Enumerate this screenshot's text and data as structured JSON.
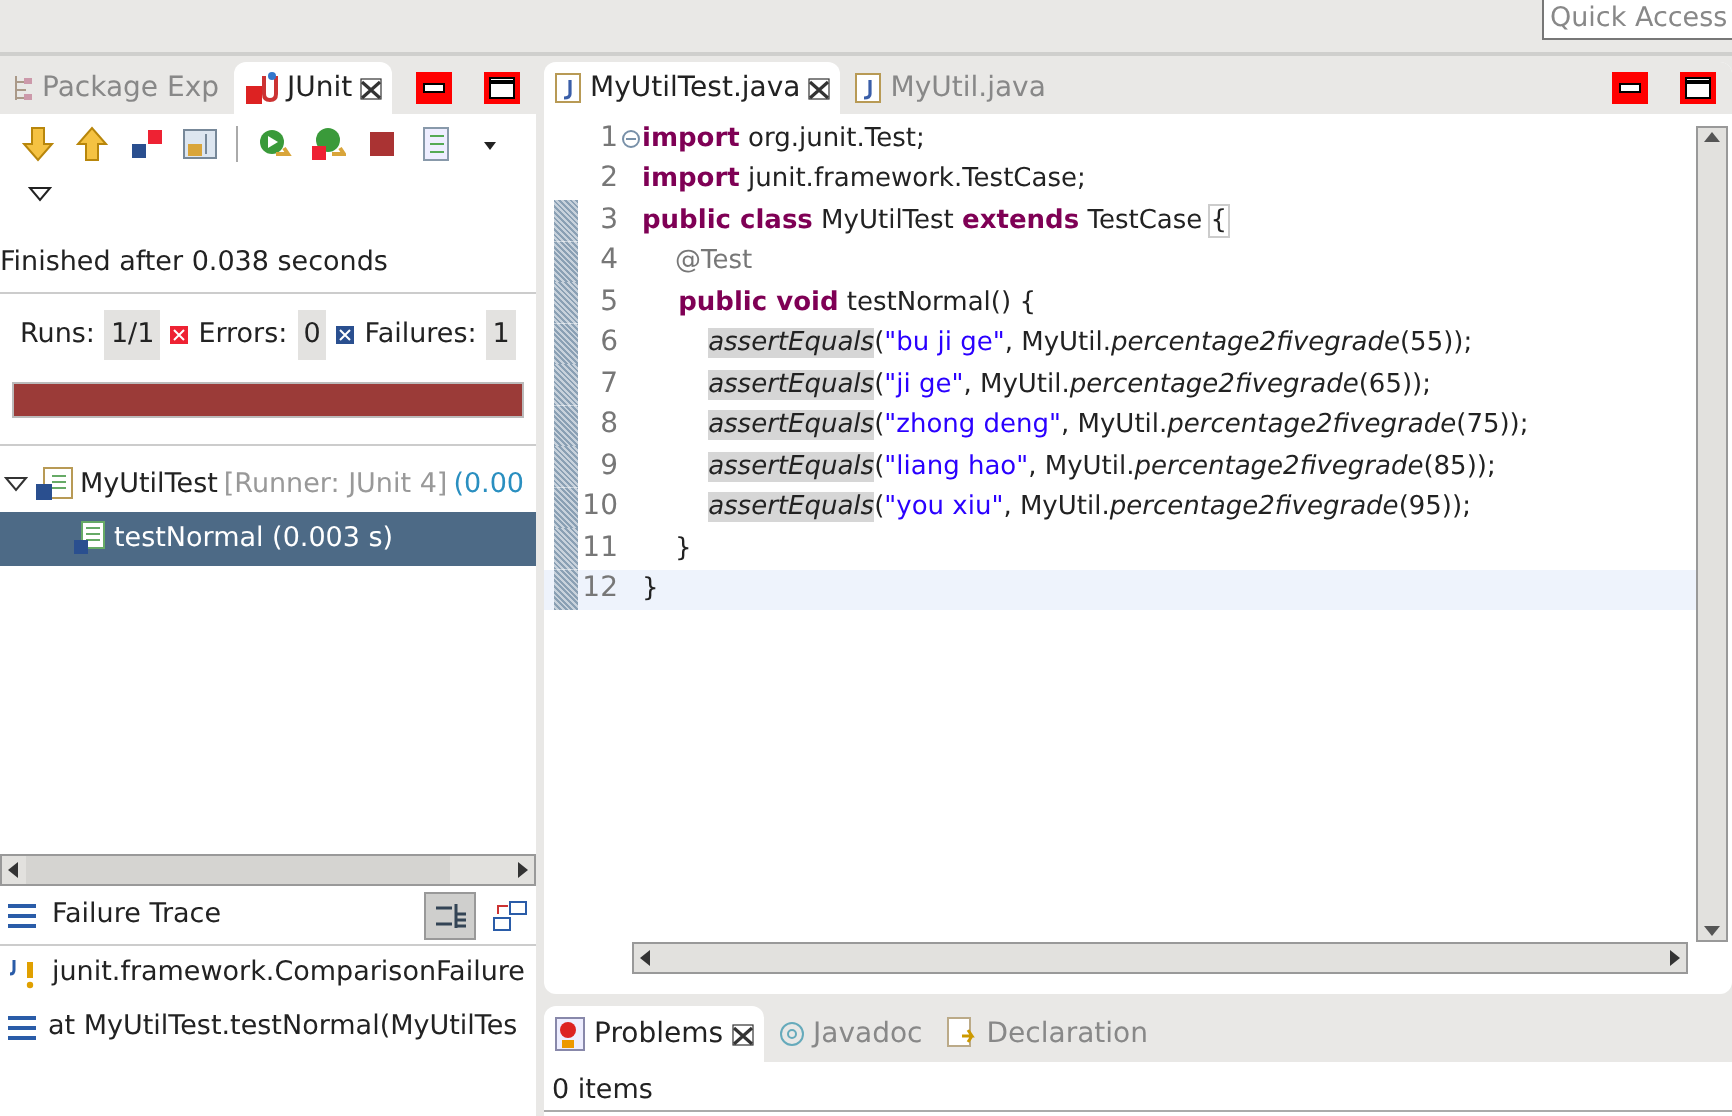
{
  "quick_access": {
    "placeholder": "Quick Access"
  },
  "left_panel": {
    "tabs": [
      {
        "label": "Package Exp",
        "kind": "package",
        "selected": false,
        "closable": false
      },
      {
        "label": "JUnit",
        "kind": "junit",
        "selected": true,
        "closable": true
      }
    ],
    "status": "Finished after 0.038 seconds",
    "counters": [
      {
        "label": "Runs:",
        "value": "1/1",
        "kind": "runs"
      },
      {
        "label": "Errors:",
        "value": "0",
        "kind": "errors"
      },
      {
        "label": "Failures:",
        "value": "1",
        "kind": "failures"
      }
    ],
    "progress": {
      "level": 1,
      "failed": true
    },
    "tree": [
      {
        "name": "MyUtilTest",
        "runner": "[Runner: JUnit 4]",
        "time": "(0.00",
        "expanded": true,
        "selected": false,
        "children": [
          {
            "name": "testNormal (0.003 s)",
            "selected": true
          }
        ]
      }
    ],
    "failure_trace": {
      "title": "Failure Trace",
      "lines": [
        {
          "text": "junit.framework.ComparisonFailure",
          "kind": "exception"
        },
        {
          "text": "at MyUtilTest.testNormal(MyUtilTes",
          "kind": "frame"
        }
      ]
    }
  },
  "editor": {
    "tabs": [
      {
        "label": "MyUtilTest.java",
        "selected": true,
        "closable": true
      },
      {
        "label": "MyUtil.java",
        "selected": false,
        "closable": false
      }
    ],
    "lines": [
      {
        "number": "1",
        "fold": true,
        "changed": false,
        "current": false,
        "tokens": [
          {
            "t": "import",
            "kind": "keyword"
          },
          {
            "t": " org.junit.Test;",
            "kind": "text"
          }
        ]
      },
      {
        "number": "2",
        "fold": false,
        "changed": false,
        "current": false,
        "tokens": [
          {
            "t": "import",
            "kind": "keyword"
          },
          {
            "t": " junit.framework.TestCase;",
            "kind": "text"
          }
        ]
      },
      {
        "number": "3",
        "fold": false,
        "changed": true,
        "current": false,
        "tokens": [
          {
            "t": "public class",
            "kind": "keyword"
          },
          {
            "t": " MyUtilTest ",
            "kind": "text"
          },
          {
            "t": "extends",
            "kind": "keyword"
          },
          {
            "t": " TestCase ",
            "kind": "text"
          },
          {
            "t": "{",
            "kind": "bracket"
          }
        ]
      },
      {
        "number": "4",
        "fold": false,
        "changed": true,
        "current": false,
        "tokens": [
          {
            "t": "    @Test",
            "kind": "annotation"
          }
        ]
      },
      {
        "number": "5",
        "fold": false,
        "changed": true,
        "current": false,
        "tokens": [
          {
            "t": "    public void",
            "kind": "keyword"
          },
          {
            "t": " testNormal() {",
            "kind": "text"
          }
        ]
      },
      {
        "number": "6",
        "fold": false,
        "changed": true,
        "current": false,
        "tokens": [
          {
            "t": "        assertEquals",
            "kind": "occurrence"
          },
          {
            "t": "(",
            "kind": "text"
          },
          {
            "t": "\"bu ji ge\"",
            "kind": "string"
          },
          {
            "t": ", MyUtil.",
            "kind": "text"
          },
          {
            "t": "percentage2fivegrade",
            "kind": "method"
          },
          {
            "t": "(55));",
            "kind": "text"
          }
        ]
      },
      {
        "number": "7",
        "fold": false,
        "changed": true,
        "current": false,
        "tokens": [
          {
            "t": "        assertEquals",
            "kind": "occurrence"
          },
          {
            "t": "(",
            "kind": "text"
          },
          {
            "t": "\"ji ge\"",
            "kind": "string"
          },
          {
            "t": ", MyUtil.",
            "kind": "text"
          },
          {
            "t": "percentage2fivegrade",
            "kind": "method"
          },
          {
            "t": "(65));",
            "kind": "text"
          }
        ]
      },
      {
        "number": "8",
        "fold": false,
        "changed": true,
        "current": false,
        "tokens": [
          {
            "t": "        assertEquals",
            "kind": "occurrence"
          },
          {
            "t": "(",
            "kind": "text"
          },
          {
            "t": "\"zhong deng\"",
            "kind": "string"
          },
          {
            "t": ", MyUtil.",
            "kind": "text"
          },
          {
            "t": "percentage2fivegrade",
            "kind": "method"
          },
          {
            "t": "(75));",
            "kind": "text"
          }
        ]
      },
      {
        "number": "9",
        "fold": false,
        "changed": true,
        "current": false,
        "tokens": [
          {
            "t": "        assertEquals",
            "kind": "occurrence"
          },
          {
            "t": "(",
            "kind": "text"
          },
          {
            "t": "\"liang hao\"",
            "kind": "string"
          },
          {
            "t": ", MyUtil.",
            "kind": "text"
          },
          {
            "t": "percentage2fivegrade",
            "kind": "method"
          },
          {
            "t": "(85));",
            "kind": "text"
          }
        ]
      },
      {
        "number": "10",
        "fold": false,
        "changed": true,
        "current": false,
        "tokens": [
          {
            "t": "        assertEquals",
            "kind": "occurrence"
          },
          {
            "t": "(",
            "kind": "text"
          },
          {
            "t": "\"you xiu\"",
            "kind": "string"
          },
          {
            "t": ", MyUtil.",
            "kind": "text"
          },
          {
            "t": "percentage2fivegrade",
            "kind": "method"
          },
          {
            "t": "(95));",
            "kind": "text"
          }
        ]
      },
      {
        "number": "11",
        "fold": false,
        "changed": true,
        "current": false,
        "tokens": [
          {
            "t": "    }",
            "kind": "text"
          }
        ]
      },
      {
        "number": "12",
        "fold": false,
        "changed": true,
        "current": true,
        "tokens": [
          {
            "t": "}",
            "kind": "text"
          }
        ]
      }
    ]
  },
  "bottom_panel": {
    "tabs": [
      {
        "label": "Problems",
        "kind": "problems",
        "selected": true,
        "closable": true
      },
      {
        "label": "Javadoc",
        "kind": "javadoc",
        "selected": false,
        "closable": false
      },
      {
        "label": "Declaration",
        "kind": "declaration",
        "selected": false,
        "closable": false
      }
    ],
    "summary": "0 items"
  }
}
